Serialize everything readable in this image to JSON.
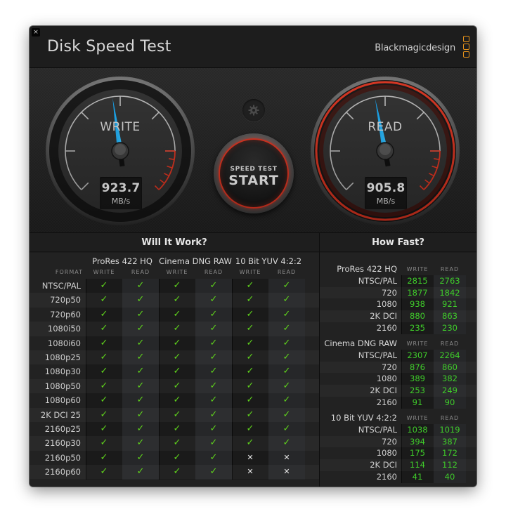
{
  "window": {
    "close_glyph": "×",
    "title": "Disk Speed Test",
    "brand": "Blackmagicdesign"
  },
  "gauges": {
    "write": {
      "label": "WRITE",
      "value": "923.7",
      "unit": "MB/s",
      "needle_fraction": 0.47
    },
    "read": {
      "label": "READ",
      "value": "905.8",
      "unit": "MB/s",
      "needle_fraction": 0.46
    }
  },
  "settings_button": {
    "icon": "gear-icon"
  },
  "start_button": {
    "top_label": "SPEED TEST",
    "main_label": "START"
  },
  "colors": {
    "accent_red": "#e0331f",
    "needle_blue": "#1aa8f0",
    "ok_green": "#5fd31c",
    "value_green": "#3fcc2a",
    "brand_orange": "#e4911a"
  },
  "will_it_work": {
    "title": "Will It Work?",
    "codecs": [
      "ProRes 422 HQ",
      "Cinema DNG RAW",
      "10 Bit YUV 4:2:2"
    ],
    "format_header": "FORMAT",
    "sub_headers": [
      "WRITE",
      "READ"
    ],
    "ok_glyph": "✓",
    "no_glyph": "✕",
    "rows": [
      {
        "format": "NTSC/PAL",
        "results": [
          true,
          true,
          true,
          true,
          true,
          true
        ]
      },
      {
        "format": "720p50",
        "results": [
          true,
          true,
          true,
          true,
          true,
          true
        ]
      },
      {
        "format": "720p60",
        "results": [
          true,
          true,
          true,
          true,
          true,
          true
        ]
      },
      {
        "format": "1080i50",
        "results": [
          true,
          true,
          true,
          true,
          true,
          true
        ]
      },
      {
        "format": "1080i60",
        "results": [
          true,
          true,
          true,
          true,
          true,
          true
        ]
      },
      {
        "format": "1080p25",
        "results": [
          true,
          true,
          true,
          true,
          true,
          true
        ]
      },
      {
        "format": "1080p30",
        "results": [
          true,
          true,
          true,
          true,
          true,
          true
        ]
      },
      {
        "format": "1080p50",
        "results": [
          true,
          true,
          true,
          true,
          true,
          true
        ]
      },
      {
        "format": "1080p60",
        "results": [
          true,
          true,
          true,
          true,
          true,
          true
        ]
      },
      {
        "format": "2K DCI 25",
        "results": [
          true,
          true,
          true,
          true,
          true,
          true
        ]
      },
      {
        "format": "2160p25",
        "results": [
          true,
          true,
          true,
          true,
          true,
          true
        ]
      },
      {
        "format": "2160p30",
        "results": [
          true,
          true,
          true,
          true,
          true,
          true
        ]
      },
      {
        "format": "2160p50",
        "results": [
          true,
          true,
          true,
          true,
          false,
          false
        ]
      },
      {
        "format": "2160p60",
        "results": [
          true,
          true,
          true,
          true,
          false,
          false
        ]
      }
    ]
  },
  "how_fast": {
    "title": "How Fast?",
    "sub_headers": [
      "WRITE",
      "READ"
    ],
    "groups": [
      {
        "codec": "ProRes 422 HQ",
        "rows": [
          {
            "label": "NTSC/PAL",
            "write": "2815",
            "read": "2763"
          },
          {
            "label": "720",
            "write": "1877",
            "read": "1842"
          },
          {
            "label": "1080",
            "write": "938",
            "read": "921"
          },
          {
            "label": "2K DCI",
            "write": "880",
            "read": "863"
          },
          {
            "label": "2160",
            "write": "235",
            "read": "230"
          }
        ]
      },
      {
        "codec": "Cinema DNG RAW",
        "rows": [
          {
            "label": "NTSC/PAL",
            "write": "2307",
            "read": "2264"
          },
          {
            "label": "720",
            "write": "876",
            "read": "860"
          },
          {
            "label": "1080",
            "write": "389",
            "read": "382"
          },
          {
            "label": "2K DCI",
            "write": "253",
            "read": "249"
          },
          {
            "label": "2160",
            "write": "91",
            "read": "90"
          }
        ]
      },
      {
        "codec": "10 Bit YUV 4:2:2",
        "rows": [
          {
            "label": "NTSC/PAL",
            "write": "1038",
            "read": "1019"
          },
          {
            "label": "720",
            "write": "394",
            "read": "387"
          },
          {
            "label": "1080",
            "write": "175",
            "read": "172"
          },
          {
            "label": "2K DCI",
            "write": "114",
            "read": "112"
          },
          {
            "label": "2160",
            "write": "41",
            "read": "40"
          }
        ]
      }
    ]
  }
}
